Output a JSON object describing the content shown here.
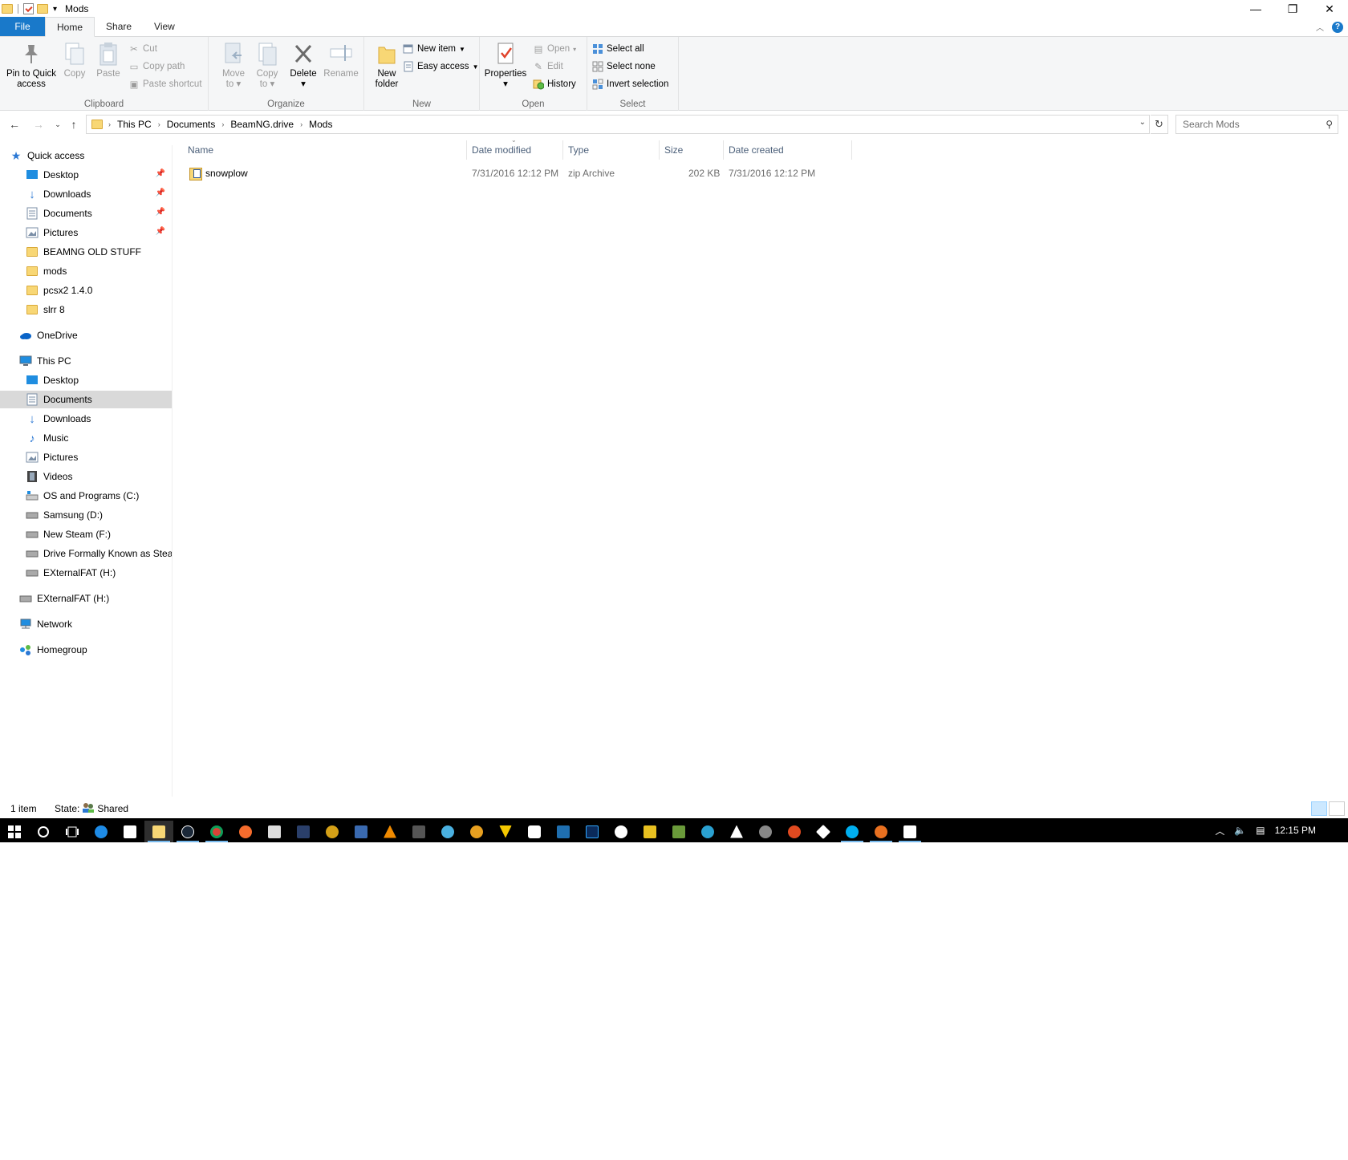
{
  "window": {
    "title": "Mods"
  },
  "ribbon_tabs": [
    "File",
    "Home",
    "Share",
    "View"
  ],
  "ribbon": {
    "clipboard": {
      "label": "Clipboard",
      "pin": "Pin to Quick access",
      "pin_line1": "Pin to Quick",
      "pin_line2": "access",
      "copy": "Copy",
      "paste": "Paste",
      "cut": "Cut",
      "copy_path": "Copy path",
      "paste_shortcut": "Paste shortcut"
    },
    "organize": {
      "label": "Organize",
      "move_to_1": "Move",
      "move_to_2": "to",
      "copy_to_1": "Copy",
      "copy_to_2": "to",
      "delete": "Delete",
      "rename": "Rename"
    },
    "new": {
      "label": "New",
      "new_folder_1": "New",
      "new_folder_2": "folder",
      "new_item": "New item",
      "easy_access": "Easy access"
    },
    "open": {
      "label": "Open",
      "properties": "Properties",
      "open": "Open",
      "edit": "Edit",
      "history": "History"
    },
    "select": {
      "label": "Select",
      "select_all": "Select all",
      "select_none": "Select none",
      "invert": "Invert selection"
    }
  },
  "address": {
    "crumbs": [
      "This PC",
      "Documents",
      "BeamNG.drive",
      "Mods"
    ],
    "search_placeholder": "Search Mods"
  },
  "nav": {
    "quick_access": "Quick access",
    "quick_items": [
      "Desktop",
      "Downloads",
      "Documents",
      "Pictures",
      "BEAMNG OLD STUFF",
      "mods",
      "pcsx2 1.4.0",
      "slrr 8"
    ],
    "onedrive": "OneDrive",
    "this_pc": "This PC",
    "pc_items": [
      "Desktop",
      "Documents",
      "Downloads",
      "Music",
      "Pictures",
      "Videos",
      "OS and Programs (C:)",
      "Samsung (D:)",
      "New Steam (F:)",
      "Drive Formally Known as Steam",
      "EXternalFAT (H:)"
    ],
    "external": "EXternalFAT (H:)",
    "network": "Network",
    "homegroup": "Homegroup"
  },
  "columns": [
    "Name",
    "Date modified",
    "Type",
    "Size",
    "Date created"
  ],
  "files": [
    {
      "name": "snowplow",
      "modified": "7/31/2016 12:12 PM",
      "type": "zip Archive",
      "size": "202 KB",
      "created": "7/31/2016 12:12 PM"
    }
  ],
  "status": {
    "count": "1 item",
    "state_label": "State:",
    "state_value": "Shared"
  },
  "taskbar": {
    "clock": "12:15 PM"
  }
}
